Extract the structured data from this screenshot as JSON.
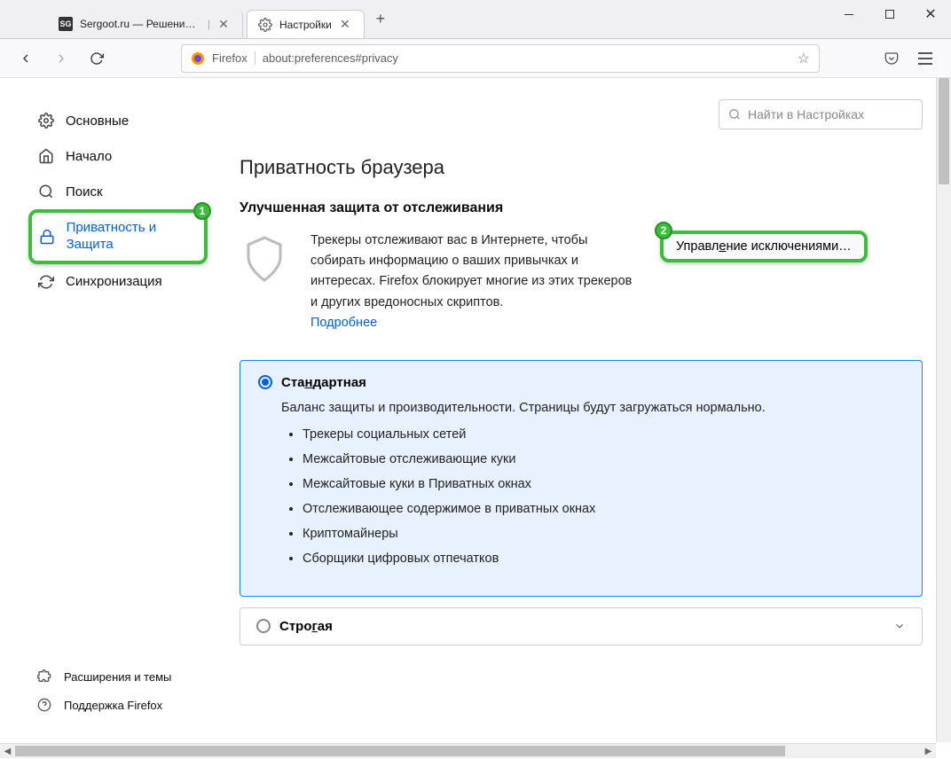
{
  "window": {
    "tabs": [
      {
        "label": "Sergoot.ru — Решение ваших",
        "favicon": "SG",
        "active": false
      },
      {
        "label": "Настройки",
        "favicon": "gear",
        "active": true
      }
    ]
  },
  "toolbar": {
    "identity": "Firefox",
    "url": "about:preferences#privacy"
  },
  "search": {
    "placeholder": "Найти в Настройках"
  },
  "sidebar": {
    "items": [
      {
        "icon": "gear",
        "label": "Основные"
      },
      {
        "icon": "home",
        "label": "Начало"
      },
      {
        "icon": "search",
        "label": "Поиск"
      },
      {
        "icon": "lock",
        "label": "Приватность и Защита",
        "selected": true,
        "badge": "1"
      },
      {
        "icon": "sync",
        "label": "Синхронизация"
      }
    ],
    "bottom": [
      {
        "icon": "puzzle",
        "label": "Расширения и темы"
      },
      {
        "icon": "help",
        "label": "Поддержка Firefox"
      }
    ]
  },
  "main": {
    "section_title": "Приватность браузера",
    "subsection_title": "Улучшенная защита от отслеживания",
    "desc_text": "Трекеры отслеживают вас в Интернете, чтобы собирать информацию о ваших привычках и интересах. Firefox блокирует многие из этих трекеров и других вредоносных скриптов.",
    "desc_link": "Подробнее",
    "exceptions_btn_pre": "Управл",
    "exceptions_btn_u": "е",
    "exceptions_btn_post": "ние исключениями…",
    "exceptions_badge": "2",
    "standard": {
      "label_pre": "Ста",
      "label_u": "н",
      "label_post": "дартная",
      "subtext": "Баланс защиты и производительности. Страницы будут загружаться нормально.",
      "items": [
        "Трекеры социальных сетей",
        "Межсайтовые отслеживающие куки",
        "Межсайтовые куки в Приватных окнах",
        "Отслеживающее содержимое в приватных окнах",
        "Криптомайнеры",
        "Сборщики цифровых отпечатков"
      ]
    },
    "strict": {
      "label_pre": "Стро",
      "label_u": "г",
      "label_post": "ая"
    }
  }
}
